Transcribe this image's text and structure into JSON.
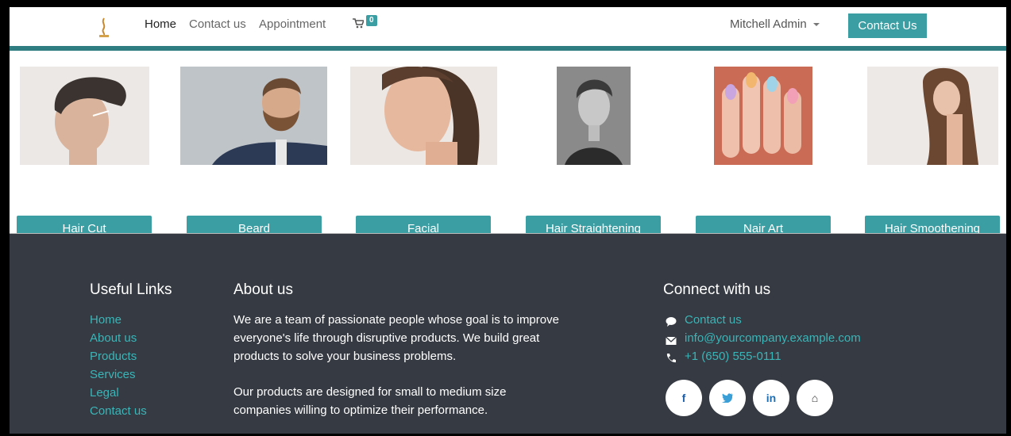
{
  "nav": {
    "links": [
      "Home",
      "Contact us",
      "Appointment"
    ],
    "cart_count": "0",
    "user": "Mitchell Admin",
    "contact_button": "Contact Us"
  },
  "services": [
    {
      "label": "Hair Cut",
      "image": "man-hair-cut-photo"
    },
    {
      "label": "Beard",
      "image": "bearded-man-photo"
    },
    {
      "label": "Facial",
      "image": "woman-face-photo"
    },
    {
      "label": "Hair Straightening",
      "image": "man-portrait-photo"
    },
    {
      "label": "Nair Art",
      "image": "nail-art-photo"
    },
    {
      "label": "Hair Smoothening",
      "image": "woman-long-hair-photo"
    }
  ],
  "footer": {
    "useful_links": {
      "title": "Useful Links",
      "items": [
        "Home",
        "About us",
        "Products",
        "Services",
        "Legal",
        "Contact us"
      ]
    },
    "about": {
      "title": "About us",
      "p1": [
        "We are a team of passionate people whose goal is to improve",
        "everyone's life through disruptive products. We build great",
        "products to solve your business problems."
      ],
      "p2": [
        "Our products are designed for small to medium size",
        "companies willing to optimize their performance."
      ]
    },
    "connect": {
      "title": "Connect with us",
      "contact": "Contact us",
      "email": "info@yourcompany.example.com",
      "phone": "+1 (650) 555-0111",
      "social": [
        {
          "name": "facebook",
          "glyph": "f"
        },
        {
          "name": "twitter",
          "glyph": "t"
        },
        {
          "name": "linkedin",
          "glyph": "in"
        },
        {
          "name": "home",
          "glyph": "⌂"
        }
      ]
    }
  },
  "colors": {
    "accent": "#3a9ea3",
    "footer_bg": "#363a42",
    "link": "#3ab5b8"
  }
}
